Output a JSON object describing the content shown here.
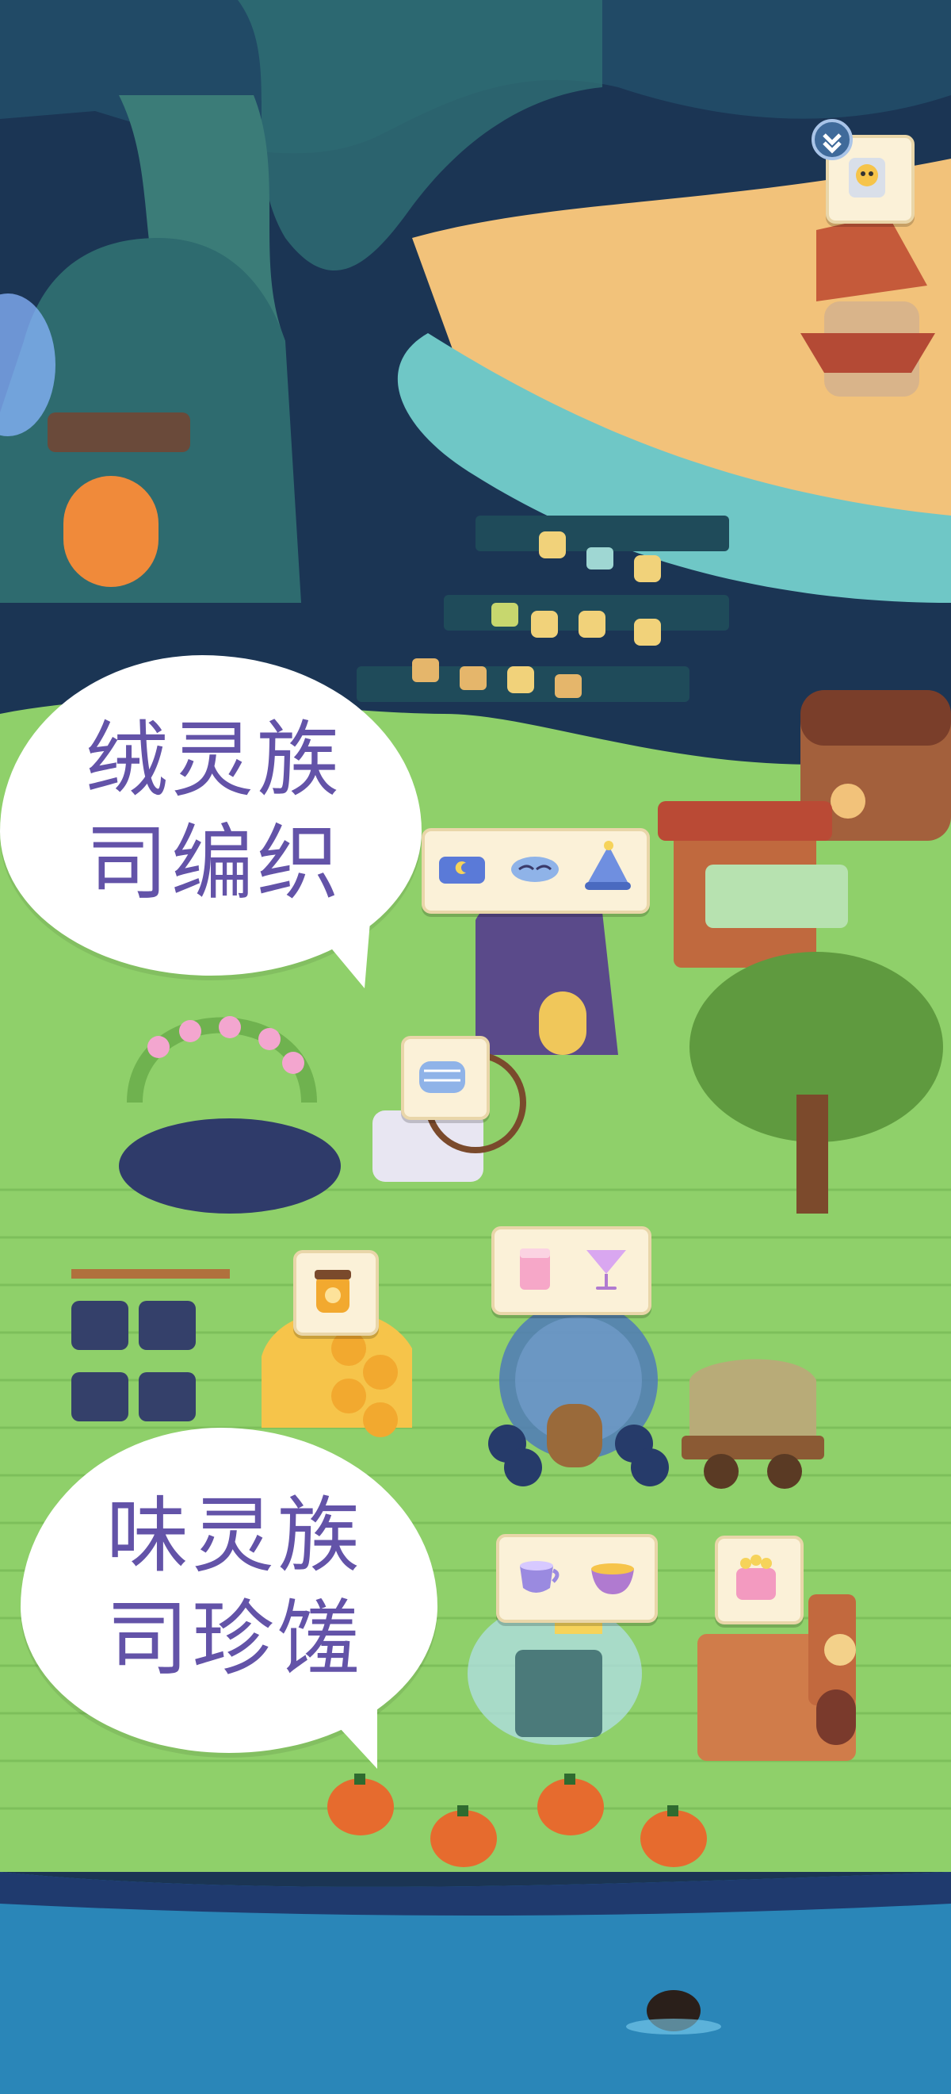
{
  "scene": {
    "name": "fairy-forest-village",
    "colors": {
      "night_sky": "#1b3554",
      "tree_teal": "#2f6f74",
      "sand": "#f2c27a",
      "river": "#6fc7c6",
      "grass": "#8fd06a",
      "grass_dark": "#6fb24f",
      "lake": "#2a86b8",
      "bubble_text": "#6353a8"
    }
  },
  "speech_bubbles": [
    {
      "id": "plush-clan",
      "line1": "绒灵族",
      "line2": "司编织"
    },
    {
      "id": "taste-clan",
      "line1": "味灵族",
      "line2": "司珍馐"
    }
  ],
  "item_cards": [
    {
      "id": "sleep-set",
      "icons": [
        "blanket-icon",
        "sleep-mask-icon",
        "nightcap-icon"
      ]
    },
    {
      "id": "fabric",
      "icons": [
        "fabric-roll-icon"
      ]
    },
    {
      "id": "honey",
      "icons": [
        "honey-jar-icon"
      ]
    },
    {
      "id": "drinks",
      "icons": [
        "juice-glass-icon",
        "cocktail-icon"
      ]
    },
    {
      "id": "tea",
      "icons": [
        "teacup-icon",
        "tea-bowl-icon"
      ]
    },
    {
      "id": "candy",
      "icons": [
        "candy-box-icon"
      ]
    },
    {
      "id": "postbox",
      "icons": [
        "mail-creature-icon"
      ]
    }
  ],
  "buildings": [
    "tree-house-post-office",
    "market-stalls",
    "windmill-hut",
    "treasure-chest-house",
    "general-store",
    "weaver-tent",
    "spinning-wheel",
    "flower-arch",
    "honey-hive",
    "bubble-cafe",
    "covered-wagon",
    "teapot-house",
    "bakery-cottage",
    "pumpkin-houses"
  ]
}
